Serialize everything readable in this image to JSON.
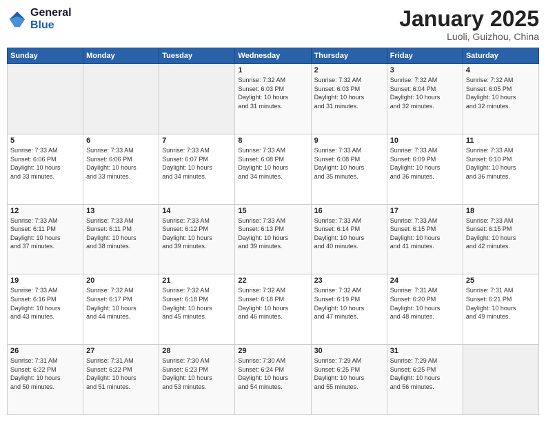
{
  "header": {
    "logo_general": "General",
    "logo_blue": "Blue",
    "month_title": "January 2025",
    "location": "Luoli, Guizhou, China"
  },
  "days_of_week": [
    "Sunday",
    "Monday",
    "Tuesday",
    "Wednesday",
    "Thursday",
    "Friday",
    "Saturday"
  ],
  "weeks": [
    [
      {
        "day": "",
        "empty": true
      },
      {
        "day": "",
        "empty": true
      },
      {
        "day": "",
        "empty": true
      },
      {
        "day": "1",
        "sunrise": "7:32 AM",
        "sunset": "6:03 PM",
        "daylight": "10 hours and 31 minutes."
      },
      {
        "day": "2",
        "sunrise": "7:32 AM",
        "sunset": "6:03 PM",
        "daylight": "10 hours and 31 minutes."
      },
      {
        "day": "3",
        "sunrise": "7:32 AM",
        "sunset": "6:04 PM",
        "daylight": "10 hours and 32 minutes."
      },
      {
        "day": "4",
        "sunrise": "7:32 AM",
        "sunset": "6:05 PM",
        "daylight": "10 hours and 32 minutes."
      }
    ],
    [
      {
        "day": "5",
        "sunrise": "7:33 AM",
        "sunset": "6:06 PM",
        "daylight": "10 hours and 33 minutes."
      },
      {
        "day": "6",
        "sunrise": "7:33 AM",
        "sunset": "6:06 PM",
        "daylight": "10 hours and 33 minutes."
      },
      {
        "day": "7",
        "sunrise": "7:33 AM",
        "sunset": "6:07 PM",
        "daylight": "10 hours and 34 minutes."
      },
      {
        "day": "8",
        "sunrise": "7:33 AM",
        "sunset": "6:08 PM",
        "daylight": "10 hours and 34 minutes."
      },
      {
        "day": "9",
        "sunrise": "7:33 AM",
        "sunset": "6:08 PM",
        "daylight": "10 hours and 35 minutes."
      },
      {
        "day": "10",
        "sunrise": "7:33 AM",
        "sunset": "6:09 PM",
        "daylight": "10 hours and 36 minutes."
      },
      {
        "day": "11",
        "sunrise": "7:33 AM",
        "sunset": "6:10 PM",
        "daylight": "10 hours and 36 minutes."
      }
    ],
    [
      {
        "day": "12",
        "sunrise": "7:33 AM",
        "sunset": "6:11 PM",
        "daylight": "10 hours and 37 minutes."
      },
      {
        "day": "13",
        "sunrise": "7:33 AM",
        "sunset": "6:11 PM",
        "daylight": "10 hours and 38 minutes."
      },
      {
        "day": "14",
        "sunrise": "7:33 AM",
        "sunset": "6:12 PM",
        "daylight": "10 hours and 39 minutes."
      },
      {
        "day": "15",
        "sunrise": "7:33 AM",
        "sunset": "6:13 PM",
        "daylight": "10 hours and 39 minutes."
      },
      {
        "day": "16",
        "sunrise": "7:33 AM",
        "sunset": "6:14 PM",
        "daylight": "10 hours and 40 minutes."
      },
      {
        "day": "17",
        "sunrise": "7:33 AM",
        "sunset": "6:15 PM",
        "daylight": "10 hours and 41 minutes."
      },
      {
        "day": "18",
        "sunrise": "7:33 AM",
        "sunset": "6:15 PM",
        "daylight": "10 hours and 42 minutes."
      }
    ],
    [
      {
        "day": "19",
        "sunrise": "7:33 AM",
        "sunset": "6:16 PM",
        "daylight": "10 hours and 43 minutes."
      },
      {
        "day": "20",
        "sunrise": "7:32 AM",
        "sunset": "6:17 PM",
        "daylight": "10 hours and 44 minutes."
      },
      {
        "day": "21",
        "sunrise": "7:32 AM",
        "sunset": "6:18 PM",
        "daylight": "10 hours and 45 minutes."
      },
      {
        "day": "22",
        "sunrise": "7:32 AM",
        "sunset": "6:18 PM",
        "daylight": "10 hours and 46 minutes."
      },
      {
        "day": "23",
        "sunrise": "7:32 AM",
        "sunset": "6:19 PM",
        "daylight": "10 hours and 47 minutes."
      },
      {
        "day": "24",
        "sunrise": "7:31 AM",
        "sunset": "6:20 PM",
        "daylight": "10 hours and 48 minutes."
      },
      {
        "day": "25",
        "sunrise": "7:31 AM",
        "sunset": "6:21 PM",
        "daylight": "10 hours and 49 minutes."
      }
    ],
    [
      {
        "day": "26",
        "sunrise": "7:31 AM",
        "sunset": "6:22 PM",
        "daylight": "10 hours and 50 minutes."
      },
      {
        "day": "27",
        "sunrise": "7:31 AM",
        "sunset": "6:22 PM",
        "daylight": "10 hours and 51 minutes."
      },
      {
        "day": "28",
        "sunrise": "7:30 AM",
        "sunset": "6:23 PM",
        "daylight": "10 hours and 53 minutes."
      },
      {
        "day": "29",
        "sunrise": "7:30 AM",
        "sunset": "6:24 PM",
        "daylight": "10 hours and 54 minutes."
      },
      {
        "day": "30",
        "sunrise": "7:29 AM",
        "sunset": "6:25 PM",
        "daylight": "10 hours and 55 minutes."
      },
      {
        "day": "31",
        "sunrise": "7:29 AM",
        "sunset": "6:25 PM",
        "daylight": "10 hours and 56 minutes."
      },
      {
        "day": "",
        "empty": true
      }
    ]
  ],
  "labels": {
    "sunrise": "Sunrise:",
    "sunset": "Sunset:",
    "daylight": "Daylight:"
  }
}
